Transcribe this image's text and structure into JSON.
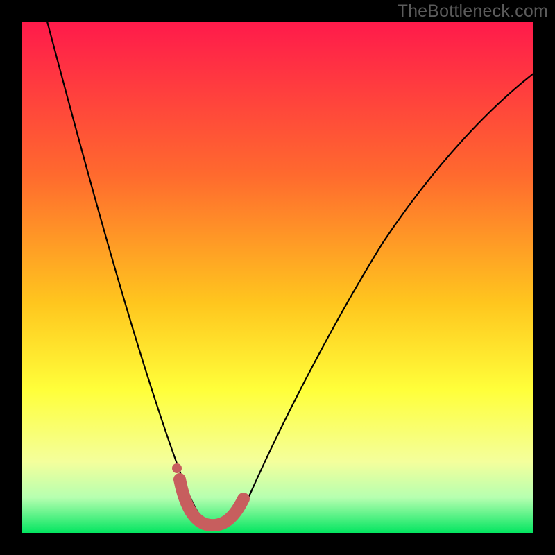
{
  "watermark": "TheBottleneck.com",
  "colors": {
    "frame": "#000000",
    "gradient_top": "#ff1a4b",
    "gradient_mid1": "#ff7a2a",
    "gradient_mid2": "#ffd21e",
    "gradient_mid3": "#ffff3a",
    "gradient_low1": "#f4ff9c",
    "gradient_low2": "#b6ffb0",
    "gradient_bottom": "#00e55f",
    "curve": "#000000",
    "accent": "#c75e5e"
  },
  "chart_data": {
    "type": "line",
    "title": "",
    "xlabel": "",
    "ylabel": "",
    "xlim": [
      0,
      100
    ],
    "ylim": [
      0,
      100
    ],
    "series": [
      {
        "name": "bottleneck-curve",
        "x": [
          5,
          10,
          15,
          20,
          25,
          28,
          30,
          32,
          34,
          36,
          38,
          40,
          45,
          50,
          55,
          60,
          65,
          70,
          75,
          80,
          85,
          90,
          95,
          100
        ],
        "y": [
          100,
          84,
          68,
          53,
          37,
          26,
          18,
          10,
          4,
          1,
          0,
          1,
          6,
          15,
          25,
          34,
          42,
          49,
          55,
          60,
          65,
          69,
          72,
          75
        ]
      }
    ],
    "accent_region": {
      "name": "optimal-u",
      "x": [
        31,
        33,
        35,
        37,
        39,
        41,
        43
      ],
      "y": [
        10,
        4,
        1,
        0,
        0.5,
        2,
        6
      ]
    },
    "accent_dot": {
      "x": 31,
      "y": 12
    },
    "background_gradient_stops": [
      {
        "pos": 0.0,
        "color": "#ff1a4b"
      },
      {
        "pos": 0.3,
        "color": "#ff6a2e"
      },
      {
        "pos": 0.55,
        "color": "#ffc61e"
      },
      {
        "pos": 0.72,
        "color": "#ffff3a"
      },
      {
        "pos": 0.86,
        "color": "#f4ff9c"
      },
      {
        "pos": 0.93,
        "color": "#b6ffb0"
      },
      {
        "pos": 1.0,
        "color": "#00e55f"
      }
    ]
  }
}
